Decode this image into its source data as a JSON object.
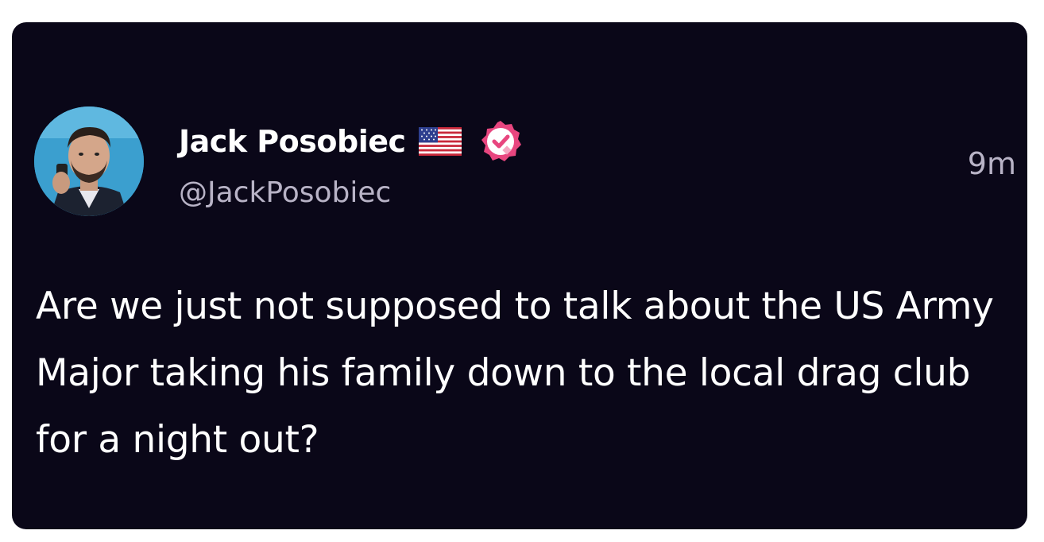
{
  "tweet": {
    "author_name": "Jack Posobiec",
    "handle": "@JackPosobiec",
    "timestamp": "9m",
    "flag_icon": "us-flag-icon",
    "verified_icon": "verified-badge-icon",
    "verified_color": "#e8467f",
    "text": "Are we just not supposed to talk about the US Army Major taking his family down to the local drag club for a night out?"
  },
  "colors": {
    "card_background": "#0a0718",
    "primary_text": "#ffffff",
    "secondary_text": "#b8b3c6"
  }
}
